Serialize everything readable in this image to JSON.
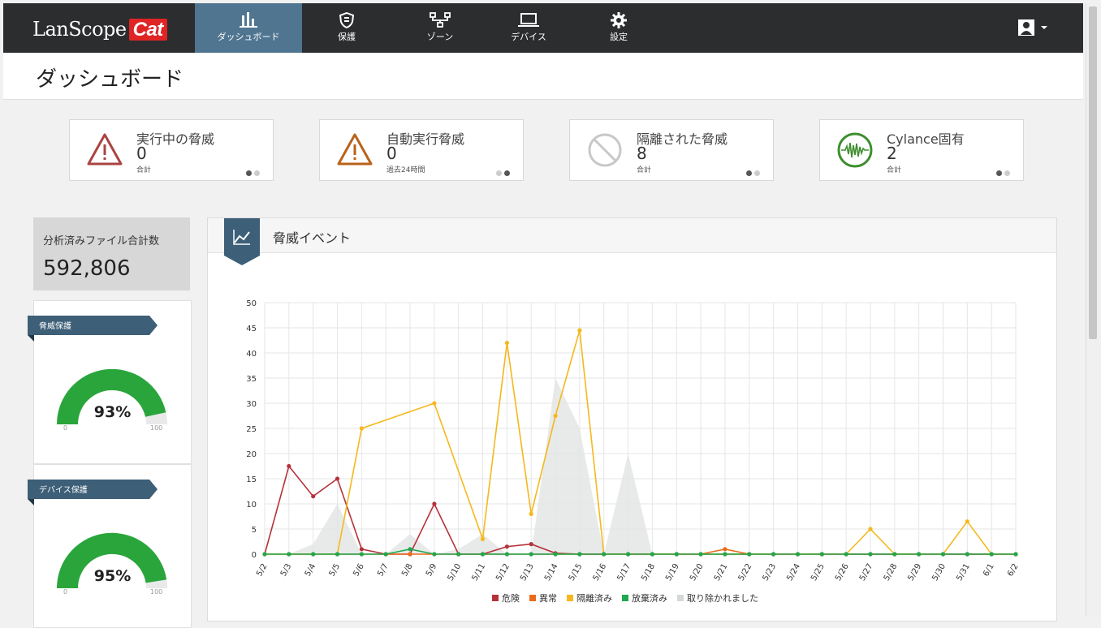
{
  "app": {
    "logo_text": "LanScope",
    "logo_badge": "Cat"
  },
  "nav": {
    "items": [
      {
        "label": "ダッシュボード",
        "icon": "bar-chart-icon"
      },
      {
        "label": "保護",
        "icon": "shield-icon"
      },
      {
        "label": "ゾーン",
        "icon": "network-icon"
      },
      {
        "label": "デバイス",
        "icon": "laptop-icon"
      },
      {
        "label": "設定",
        "icon": "gear-icon"
      }
    ],
    "user_icon": "user-icon"
  },
  "page": {
    "title": "ダッシュボード"
  },
  "stats": [
    {
      "title": "実行中の脅威",
      "value": "0",
      "sub": "合計",
      "icon": "warning-icon",
      "color": "#a94442"
    },
    {
      "title": "自動実行脅威",
      "value": "0",
      "sub": "過去24時間",
      "icon": "warning-icon",
      "color": "#b8621b"
    },
    {
      "title": "隔離された脅威",
      "value": "8",
      "sub": "合計",
      "icon": "blocked-icon",
      "color": "#c8c8c8"
    },
    {
      "title": "Cylance固有",
      "value": "2",
      "sub": "合計",
      "icon": "waveform-icon",
      "color": "#3e8e2e"
    }
  ],
  "files": {
    "label": "分析済みファイル合計数",
    "value": "592,806"
  },
  "gauges": [
    {
      "label": "脅威保護",
      "value": "93%",
      "pct": 93,
      "min": "0",
      "max": "100"
    },
    {
      "label": "デバイス保護",
      "value": "95%",
      "pct": 95,
      "min": "0",
      "max": "100"
    }
  ],
  "events_panel": {
    "title": "脅威イベント"
  },
  "colors": {
    "nav_bg": "#2b2d2f",
    "nav_active": "#4f7590",
    "danger": "#b5323a",
    "abnormal": "#ea6b1c",
    "quarantined": "#f5b81c",
    "discarded": "#1fa84f",
    "removed": "#e2e5e5",
    "gauge": "#2aa53b"
  },
  "chart_data": {
    "type": "line",
    "categories": [
      "5/2",
      "5/3",
      "5/4",
      "5/5",
      "5/6",
      "5/7",
      "5/8",
      "5/9",
      "5/10",
      "5/11",
      "5/12",
      "5/13",
      "5/14",
      "5/15",
      "5/16",
      "5/17",
      "5/18",
      "5/19",
      "5/20",
      "5/21",
      "5/22",
      "5/23",
      "5/24",
      "5/25",
      "5/26",
      "5/27",
      "5/28",
      "5/29",
      "5/30",
      "5/31",
      "6/1",
      "6/2"
    ],
    "ylim": [
      0,
      50
    ],
    "yticks": [
      "0",
      "5",
      "10",
      "15",
      "20",
      "25",
      "30",
      "35",
      "40",
      "45",
      "50"
    ],
    "grid": true,
    "legend_position": "bottom",
    "series": [
      {
        "name": "危険",
        "color": "#b5323a",
        "kind": "line",
        "values": [
          0,
          17.5,
          11.5,
          15,
          1,
          0,
          0,
          10,
          0,
          0,
          1.5,
          2,
          0.2,
          0,
          0,
          0,
          0,
          0,
          0,
          0,
          0,
          0,
          0,
          0,
          0,
          0,
          0,
          0,
          0,
          0,
          0,
          0
        ]
      },
      {
        "name": "異常",
        "color": "#ea6b1c",
        "kind": "line",
        "values": [
          0,
          0,
          0,
          0,
          0,
          0,
          0,
          0,
          0,
          0,
          0,
          0,
          0,
          0,
          0,
          0,
          0,
          0,
          0,
          1,
          0,
          0,
          0,
          0,
          0,
          0,
          0,
          0,
          0,
          0,
          0,
          0
        ]
      },
      {
        "name": "隔離済み",
        "color": "#f5b81c",
        "kind": "line",
        "values": [
          0,
          0,
          0,
          0,
          25,
          null,
          null,
          30,
          null,
          3,
          42,
          8,
          27.5,
          44.5,
          0,
          0,
          0,
          0,
          0,
          0,
          0,
          0,
          0,
          0,
          0,
          5,
          0,
          0,
          0,
          6.5,
          0,
          0
        ]
      },
      {
        "name": "放棄済み",
        "color": "#1fa84f",
        "kind": "line",
        "values": [
          0,
          0,
          0,
          0,
          0,
          0,
          1,
          0,
          0,
          0,
          0,
          0,
          0,
          0,
          0,
          0,
          0,
          0,
          0,
          0,
          0,
          0,
          0,
          0,
          0,
          0,
          0,
          0,
          0,
          0,
          0,
          0
        ]
      },
      {
        "name": "取り除かれました",
        "color": "#e2e5e5",
        "kind": "area",
        "values": [
          0,
          0,
          2,
          10,
          0,
          0,
          4,
          0,
          1,
          4,
          0,
          0,
          35,
          25,
          0,
          20,
          0,
          0,
          0,
          0,
          0,
          0,
          0,
          0,
          0,
          0,
          0,
          0,
          0,
          0,
          0,
          0
        ]
      }
    ]
  }
}
